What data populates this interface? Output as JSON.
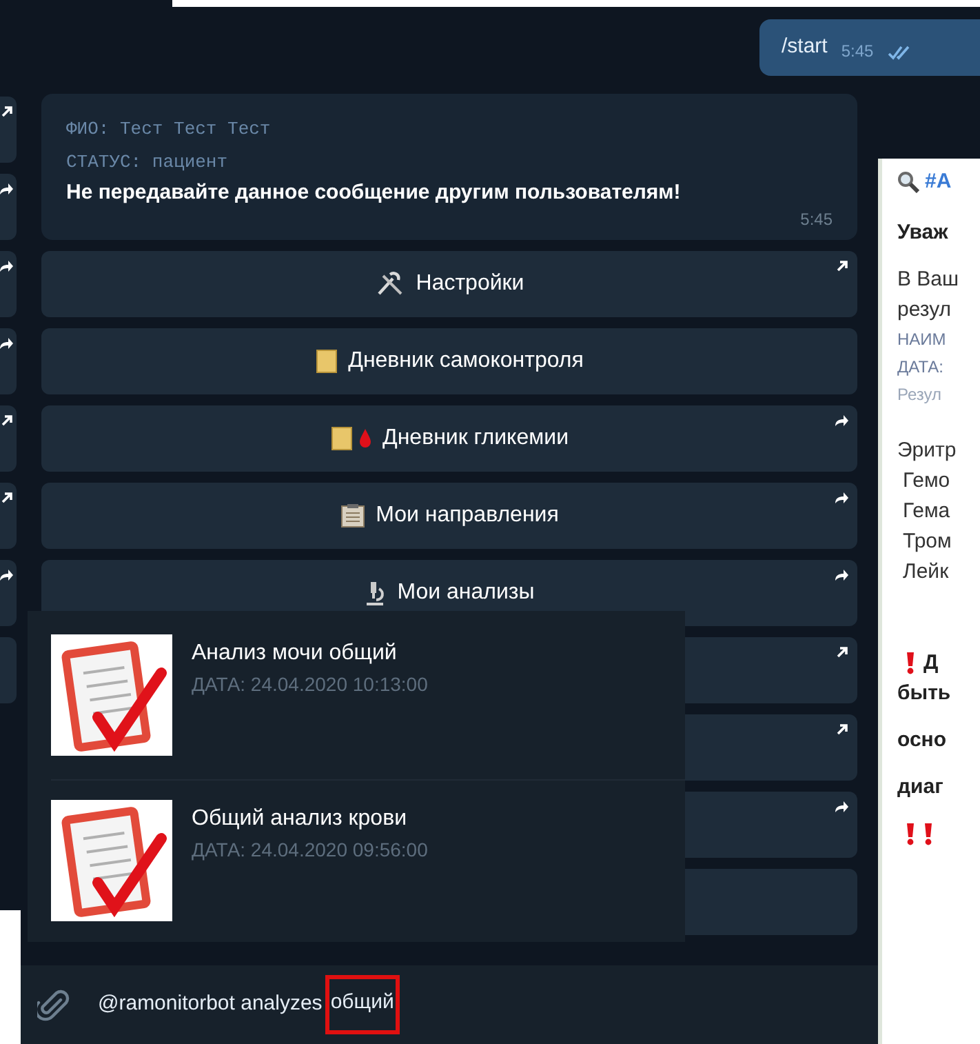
{
  "side_chat": {
    "buttons": [
      {
        "kind": "url"
      },
      {
        "kind": "inline"
      },
      {
        "kind": "inline"
      },
      {
        "kind": "inline"
      },
      {
        "kind": "url"
      },
      {
        "kind": "url"
      },
      {
        "kind": "inline"
      },
      {
        "kind": "plain"
      }
    ]
  },
  "outgoing_message": {
    "text": "/start",
    "time": "5:45",
    "read": true
  },
  "incoming_message": {
    "lines": [
      "ФИО: Тест Тест Тест",
      "СТАТУС: пациент"
    ],
    "text": "Не передавайте данное сообщение другим пользователям!",
    "time": "5:45"
  },
  "keyboard": [
    {
      "label": "Настройки",
      "kind": "url"
    },
    {
      "label": "Дневник самоконтроля",
      "kind": "plain"
    },
    {
      "label": "Дневник гликемии",
      "kind": "inline"
    },
    {
      "label": "Мои направления",
      "kind": "inline"
    },
    {
      "label": "Мои анализы",
      "kind": "inline"
    },
    {
      "kind": "url"
    },
    {
      "kind": "url"
    },
    {
      "kind": "inline"
    },
    {
      "kind": "plain"
    }
  ],
  "inline_results": [
    {
      "title": "Анализ мочи общий",
      "date": "ДАТА: 24.04.2020 10:13:00"
    },
    {
      "title": "Общий анализ крови",
      "date": "ДАТА: 24.04.2020 09:56:00"
    }
  ],
  "input": {
    "value": "@ramonitorbot analyzes",
    "highlighted": "общий"
  },
  "side_document": {
    "lines": [
      {
        "text": "#А",
        "kind": "search"
      },
      {
        "text": "Уваж",
        "kind": "bold"
      },
      {
        "text": "В Ваш",
        "kind": "plain"
      },
      {
        "text": "резул",
        "kind": "plain"
      },
      {
        "text": "НАИМ",
        "kind": "small"
      },
      {
        "text": "ДАТА:",
        "kind": "small"
      },
      {
        "text": "Резул",
        "kind": "faint"
      },
      {
        "text": "Эритр",
        "kind": "plain"
      },
      {
        "text": "Гемо",
        "kind": "indent"
      },
      {
        "text": "Гема",
        "kind": "indent"
      },
      {
        "text": "Тром",
        "kind": "indent"
      },
      {
        "text": "Лейк",
        "kind": "indent"
      },
      {
        "text": "Д",
        "kind": "alert"
      },
      {
        "text": "быть",
        "kind": "bold"
      },
      {
        "text": "осно",
        "kind": "bold"
      },
      {
        "text": "диаг",
        "kind": "bold"
      },
      {
        "kind": "alerts"
      }
    ]
  }
}
